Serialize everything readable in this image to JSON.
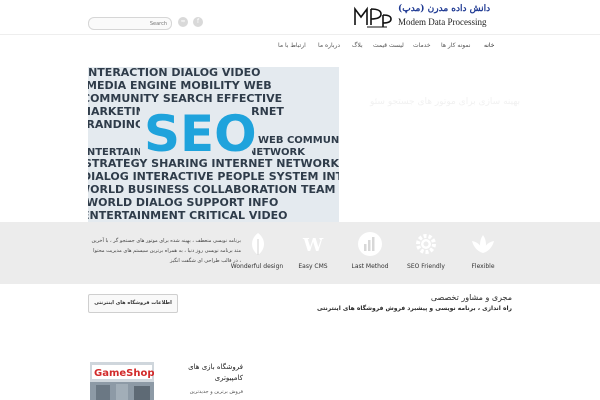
{
  "header": {
    "search_placeholder": "Search",
    "social": {
      "rss_icon": "rss-icon",
      "facebook_icon": "facebook-icon"
    },
    "logo": {
      "mark": "MDP",
      "title_fa": "دانش ‌داده ‌مدرن (مدپ)",
      "subtitle": "Modem Data Processing"
    }
  },
  "nav": {
    "items": [
      {
        "label": "خانه",
        "active": true
      },
      {
        "label": "نمونه کار ها"
      },
      {
        "label": "خدمات"
      },
      {
        "label": "لیست قیمت"
      },
      {
        "label": "بلاگ"
      },
      {
        "label": "درباره ما"
      },
      {
        "label": "ارتباط با ما"
      }
    ]
  },
  "hero": {
    "image_text": {
      "big": "SEO",
      "words": [
        "INTERACTION DIALOG VIDEO",
        "MEDIA ENGINE MOBILITY WEB",
        "COMMUNITY SEARCH EFFECTIVE",
        "MARKETING BUSINESS INTERNET",
        "BRANDING SEO FEEDBACK",
        "WEB COMMUNICATION",
        "ENTERTAINMENT MARKETING NETWORK",
        "STRATEGY SHARING INTERNET NETWORK WORK",
        "DIALOG INTERACTIVE PEOPLE SYSTEM INTERNET",
        "WORLD BUSINESS COLLABORATION TEAM",
        "WORLD DIALOG SUPPORT INFO",
        "ENTERTAINMENT CRITICAL VIDEO"
      ]
    },
    "caption": "بهینه سازی برای موتور های جستجو سئو"
  },
  "features": {
    "description": "برنامه نویسی منعطف ، بهینه شده برای موتور های جستجو گر ، با آخرین متد برنامه نویسی روز دنیا ، به همراه برترین سیستم های مدیریت محتوا ، در قالب طراحی ای شگفت انگیز",
    "items": [
      {
        "label": "Wonderful design",
        "icon": "leaf-icon"
      },
      {
        "label": "Easy CMS",
        "icon": "wordpress-icon"
      },
      {
        "label": "Last Method",
        "icon": "bar-chart-icon"
      },
      {
        "label": "SEO Friendly",
        "icon": "gear-icon"
      },
      {
        "label": "Flexible",
        "icon": "lotus-icon"
      }
    ]
  },
  "cta": {
    "title": "مجری و مشاور تخصصی",
    "description": "راه اندازی ، برنامه نویسی و پیشبرد فروش فروشگاه های اینترنتی",
    "button": "اطلاعات فروشگاه های اینترنتی"
  },
  "portfolio": {
    "thumb_brand": "GameShop",
    "title": "فروشگاه بازی های کامپیوتری",
    "desc": "فروش برترین و جدیدترین"
  }
}
